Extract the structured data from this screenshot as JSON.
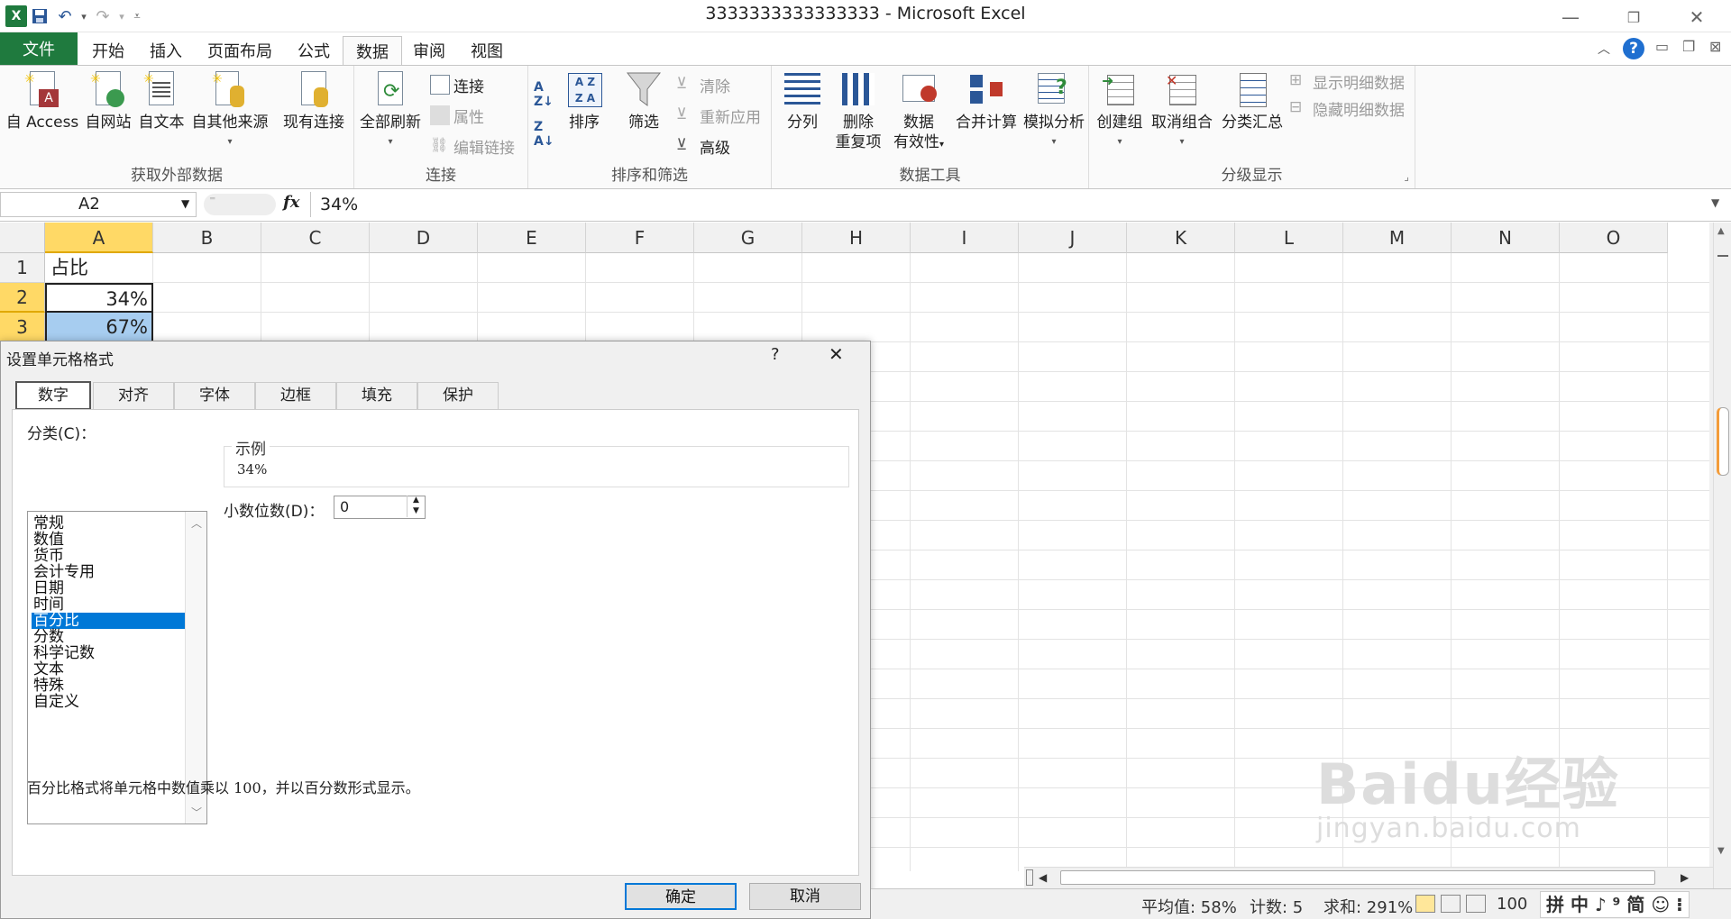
{
  "app": {
    "window_title": "3333333333333333  -  Microsoft Excel"
  },
  "tabs": [
    {
      "label": "文件"
    },
    {
      "label": "开始"
    },
    {
      "label": "插入"
    },
    {
      "label": "页面布局"
    },
    {
      "label": "公式"
    },
    {
      "label": "数据"
    },
    {
      "label": "审阅"
    },
    {
      "label": "视图"
    }
  ],
  "ribbon": {
    "get_external": {
      "label": "获取外部数据",
      "access": "自 Access",
      "web": "自网站",
      "text": "自文本",
      "other": "自其他来源",
      "existing": "现有连接"
    },
    "connections": {
      "label": "连接",
      "refresh_all": "全部刷新",
      "connections": "连接",
      "properties": "属性",
      "edit_links": "编辑链接"
    },
    "sort_filter": {
      "label": "排序和筛选",
      "sort": "排序",
      "filter": "筛选",
      "clear": "清除",
      "reapply": "重新应用",
      "advanced": "高级"
    },
    "data_tools": {
      "label": "数据工具",
      "text_to_columns": "分列",
      "remove_dup_1": "删除",
      "remove_dup_2": "重复项",
      "validation_1": "数据",
      "validation_2": "有效性",
      "consolidate": "合并计算",
      "what_if": "模拟分析"
    },
    "outline": {
      "label": "分级显示",
      "group": "创建组",
      "ungroup": "取消组合",
      "subtotal": "分类汇总",
      "show_detail": "显示明细数据",
      "hide_detail": "隐藏明细数据"
    }
  },
  "formula_bar": {
    "name_box": "A2",
    "fx": "fx",
    "value": "34%"
  },
  "grid": {
    "columns": [
      "A",
      "B",
      "C",
      "D",
      "E",
      "F",
      "G",
      "H",
      "I",
      "J",
      "K",
      "L",
      "M",
      "N",
      "O"
    ],
    "rows": [
      "1",
      "2",
      "3"
    ],
    "cells": {
      "a1": "占比",
      "a2": "34%",
      "a3": "67%"
    }
  },
  "dialog": {
    "title": "设置单元格格式",
    "help": "?",
    "close": "✕",
    "tabs": [
      "数字",
      "对齐",
      "字体",
      "边框",
      "填充",
      "保护"
    ],
    "category_label": "分类(C)：",
    "categories": [
      "常规",
      "数值",
      "货币",
      "会计专用",
      "日期",
      "时间",
      "百分比",
      "分数",
      "科学记数",
      "文本",
      "特殊",
      "自定义"
    ],
    "selected_category": "百分比",
    "sample_label": "示例",
    "sample_value": "34%",
    "decimal_label": "小数位数(D)：",
    "decimal_value": "0",
    "description": "百分比格式将单元格中数值乘以 100，并以百分数形式显示。",
    "ok": "确定",
    "cancel": "取消"
  },
  "status_bar": {
    "average": "平均值: 58%",
    "count": "计数: 5",
    "sum": "求和: 291%",
    "zoom": "100",
    "ime": "拼 中 ♪ ⁹ 简 ☺ ⁝"
  },
  "watermark": {
    "text": "Baidu经验",
    "sub": "jingyan.baidu.com"
  },
  "colors": {
    "excel_green": "#1f7a3e",
    "selection_blue": "#0078d7",
    "header_highlight": "#ffd966"
  }
}
